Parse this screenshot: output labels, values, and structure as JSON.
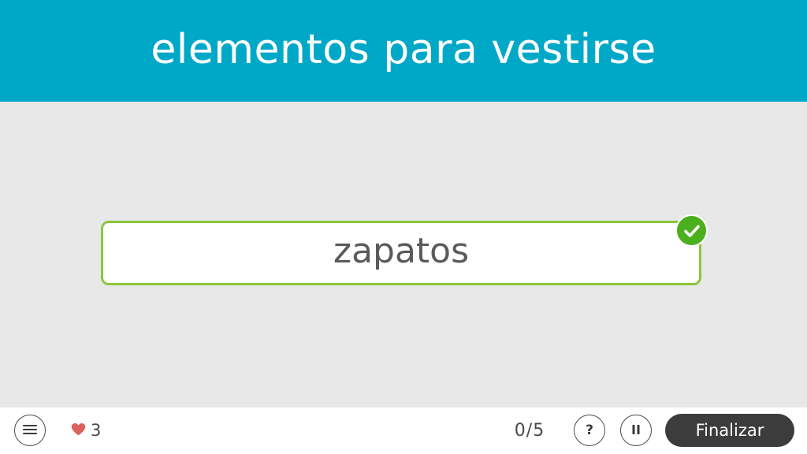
{
  "colors": {
    "header_bg": "#00a8c8",
    "answer_border": "#8cc63f",
    "check_green": "#4caf1e",
    "heart": "#d9625e",
    "finish_bg": "#3c3c3c"
  },
  "header": {
    "title": "elementos para vestirse"
  },
  "answer": {
    "text": "zapatos",
    "status_icon": "check-icon"
  },
  "footer": {
    "menu_icon": "hamburger-menu-icon",
    "lives_icon": "heart-icon",
    "lives": "3",
    "progress": "0/5",
    "help_label": "?",
    "pause_icon": "pause-icon",
    "finish_label": "Finalizar"
  }
}
